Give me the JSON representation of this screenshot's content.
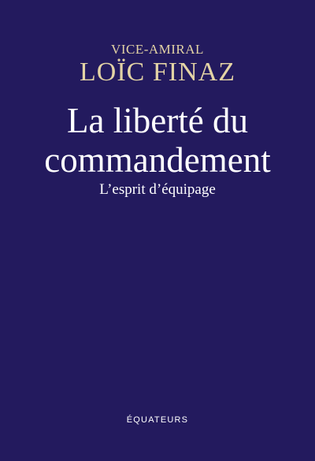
{
  "book": {
    "author_rank": "VICE-AMIRAL",
    "author_name": "LOÏC FINAZ",
    "title_line1": "La liberté du",
    "title_line2": "commandement",
    "subtitle": "L’esprit d’équipage",
    "publisher": "ÉQUATEURS"
  },
  "colors": {
    "background": "#231a5e",
    "author_text": "#e3d3a5",
    "title_text": "#ffffff"
  }
}
